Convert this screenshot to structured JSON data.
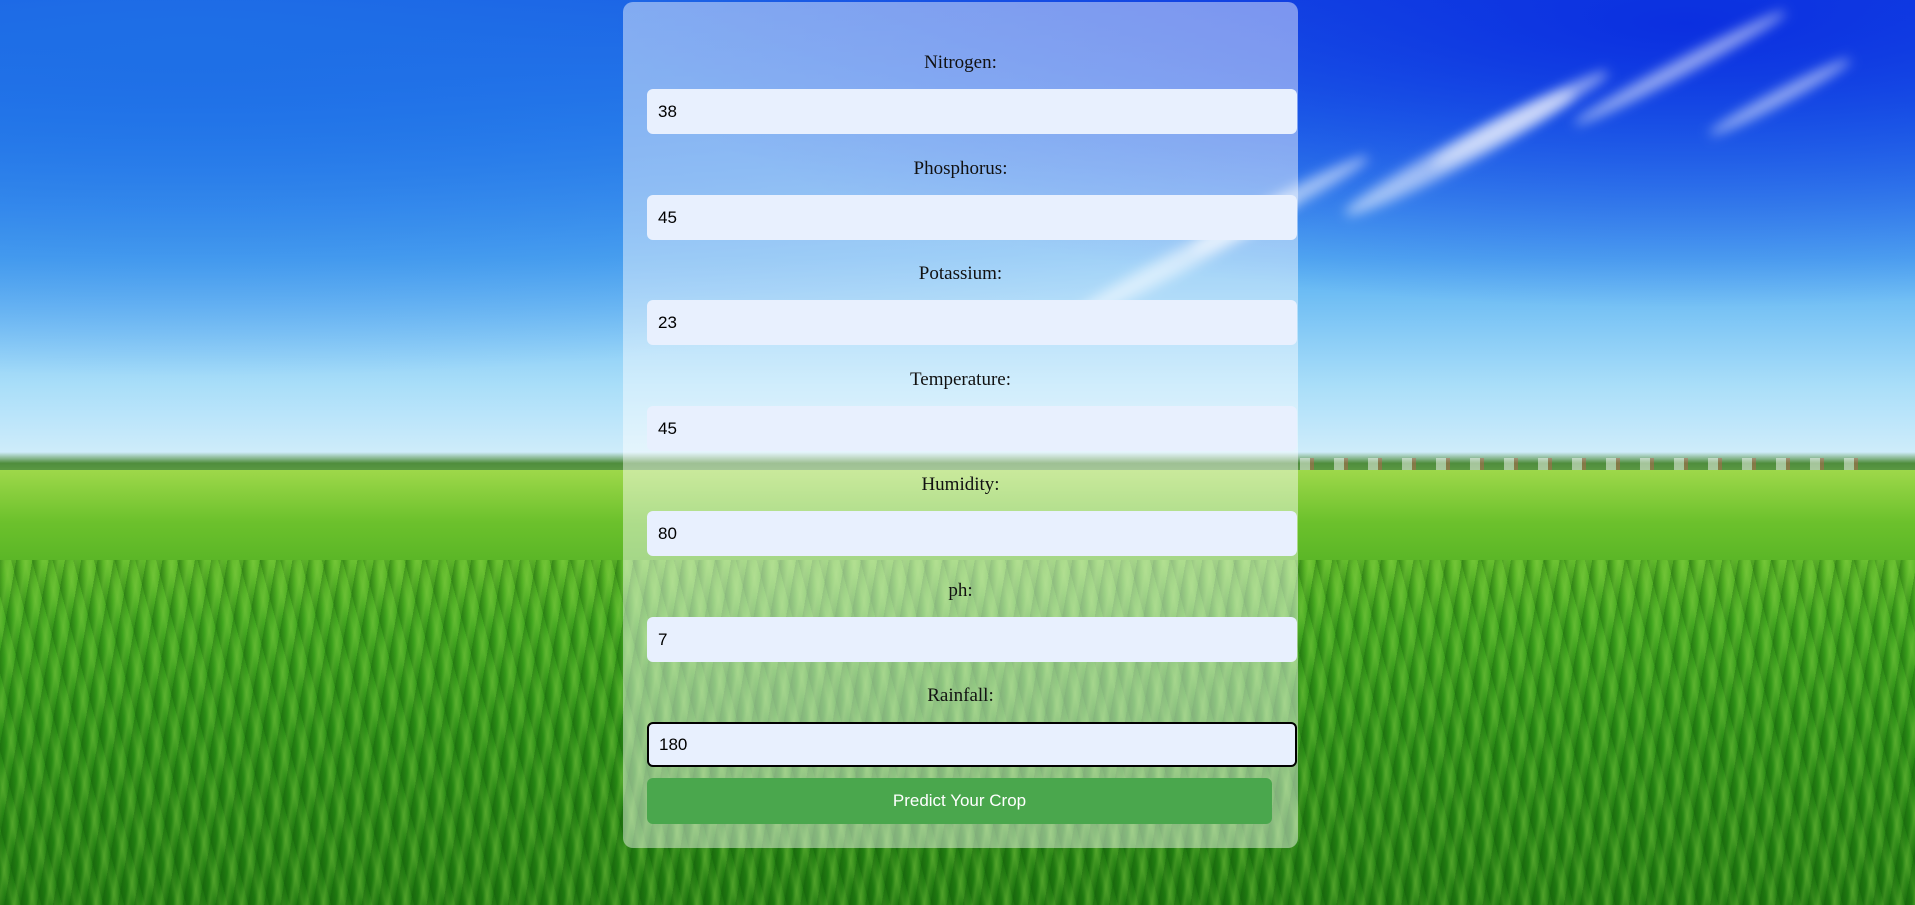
{
  "background": {
    "description_icon": "landscape-background",
    "sky_color": "#2f86ee",
    "grass_color": "#3fa51e"
  },
  "form": {
    "fields": [
      {
        "label": "Nitrogen:",
        "value": "38"
      },
      {
        "label": "Phosphorus:",
        "value": "45"
      },
      {
        "label": "Potassium:",
        "value": "23"
      },
      {
        "label": "Temperature:",
        "value": "45"
      },
      {
        "label": "Humidity:",
        "value": "80"
      },
      {
        "label": "ph:",
        "value": "7"
      },
      {
        "label": "Rainfall:",
        "value": "180"
      }
    ],
    "submit_label": "Predict Your Crop",
    "submit_color": "#4aa74d",
    "input_background": "#e8f0fe"
  }
}
